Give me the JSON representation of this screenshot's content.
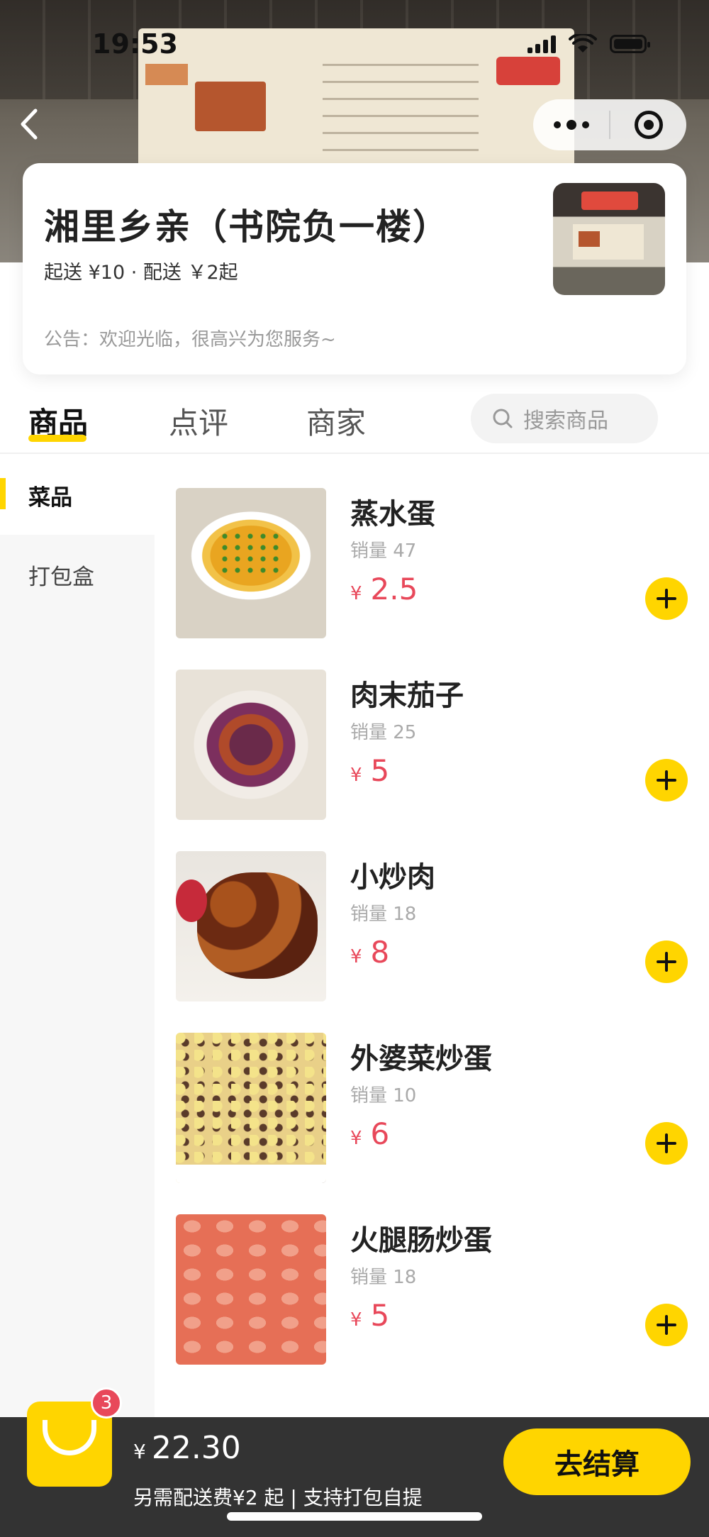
{
  "status_bar": {
    "time": "19:53"
  },
  "store": {
    "name": "湘里乡亲（书院负一楼）",
    "meta": "起送 ¥10 · 配送 ￥2起",
    "notice": "公告：欢迎光临，很高兴为您服务~"
  },
  "tabs": [
    "商品",
    "点评",
    "商家"
  ],
  "search": {
    "placeholder": "搜索商品"
  },
  "categories": [
    "菜品",
    "打包盒"
  ],
  "products": [
    {
      "name": "蒸水蛋",
      "sales": "销量 47",
      "currency": "¥",
      "price": "2.5"
    },
    {
      "name": "肉末茄子",
      "sales": "销量 25",
      "currency": "¥",
      "price": "5"
    },
    {
      "name": "小炒肉",
      "sales": "销量 18",
      "currency": "¥",
      "price": "8"
    },
    {
      "name": "外婆菜炒蛋",
      "sales": "销量 10",
      "currency": "¥",
      "price": "6"
    },
    {
      "name": "火腿肠炒蛋",
      "sales": "销量 18",
      "currency": "¥",
      "price": "5"
    }
  ],
  "cart": {
    "count": "3",
    "currency": "¥",
    "total": "22.30",
    "note": "另需配送费¥2 起 | 支持打包自提",
    "checkout_label": "去结算"
  },
  "colors": {
    "accent": "#ffd500",
    "price": "#e8485a",
    "cart_bar": "#333333"
  },
  "icons": {
    "back": "chevron-left-icon",
    "more": "more-dots-icon",
    "close": "target-circle-icon",
    "search": "search-icon",
    "add": "plus-icon",
    "cart": "cart-bag-icon"
  }
}
